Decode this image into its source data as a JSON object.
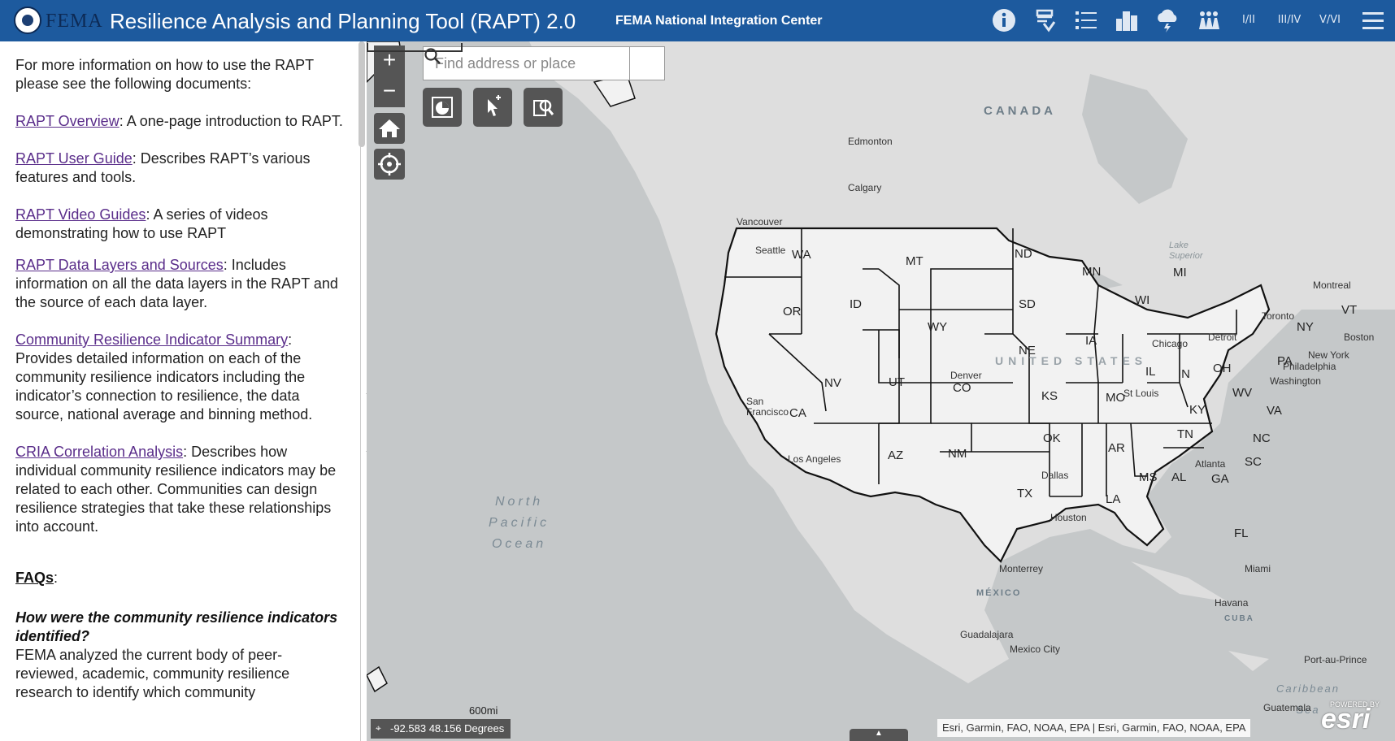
{
  "header": {
    "agency": "FEMA",
    "title": "Resilience Analysis and Planning Tool (RAPT) 2.0",
    "center": "FEMA National Integration Center",
    "icons": [
      "info-icon",
      "layer-list-icon",
      "legend-icon",
      "building-icon",
      "storm-icon",
      "population-icon",
      "region-i-ii-icon",
      "region-iii-iv-icon",
      "region-v-vi-icon",
      "menu-icon"
    ],
    "icon_labels": {
      "r12": "I/II",
      "r34": "III/IV",
      "r56": "V/VI"
    }
  },
  "panel": {
    "intro": "For more information on how to use the RAPT please see the following documents:",
    "docs": [
      {
        "link": "RAPT Overview",
        "text": ": A one-page introduction to RAPT."
      },
      {
        "link": "RAPT User Guide",
        "text": ": Describes RAPT’s various features and tools."
      },
      {
        "link": "RAPT Video Guides",
        "text": ": A series of videos demonstrating how to use RAPT"
      },
      {
        "link": "RAPT Data Layers and Sources",
        "text": ": Includes information on all the data layers in the RAPT and the source of each data layer."
      },
      {
        "link": "Community Resilience Indicator Summary",
        "text": ": Provides detailed information on each of the community resilience indicators including the indicator’s connection to resilience, the data source, national average and binning method."
      },
      {
        "link": "CRIA Correlation Analysis",
        "text": ": Describes how individual community resilience indicators may be related to each other. Communities can design resilience strategies that take these relationships into account."
      }
    ],
    "faq_heading": "FAQs",
    "faq_colon": ":",
    "faq_question": "How were the community resilience indicators identified?",
    "faq_answer": "FEMA analyzed the current body of peer-reviewed, academic, community resilience research to identify which community"
  },
  "map": {
    "search_placeholder": "Find address or place",
    "zoom_in": "+",
    "zoom_out": "−",
    "states": [
      {
        "abbr": "WA"
      },
      {
        "abbr": "OR"
      },
      {
        "abbr": "CA"
      },
      {
        "abbr": "ID"
      },
      {
        "abbr": "NV"
      },
      {
        "abbr": "MT"
      },
      {
        "abbr": "WY"
      },
      {
        "abbr": "UT"
      },
      {
        "abbr": "AZ"
      },
      {
        "abbr": "CO"
      },
      {
        "abbr": "NM"
      },
      {
        "abbr": "ND"
      },
      {
        "abbr": "SD"
      },
      {
        "abbr": "NE"
      },
      {
        "abbr": "KS"
      },
      {
        "abbr": "OK"
      },
      {
        "abbr": "TX"
      },
      {
        "abbr": "MN"
      },
      {
        "abbr": "IA"
      },
      {
        "abbr": "MO"
      },
      {
        "abbr": "AR"
      },
      {
        "abbr": "LA"
      },
      {
        "abbr": "WI"
      },
      {
        "abbr": "IL"
      },
      {
        "abbr": "MI"
      },
      {
        "abbr": "IN"
      },
      {
        "abbr": "OH"
      },
      {
        "abbr": "KY"
      },
      {
        "abbr": "TN"
      },
      {
        "abbr": "MS"
      },
      {
        "abbr": "AL"
      },
      {
        "abbr": "GA"
      },
      {
        "abbr": "FL"
      },
      {
        "abbr": "SC"
      },
      {
        "abbr": "NC"
      },
      {
        "abbr": "VA"
      },
      {
        "abbr": "WV"
      },
      {
        "abbr": "PA"
      },
      {
        "abbr": "NY"
      },
      {
        "abbr": "VT"
      }
    ],
    "cities": [
      "Edmonton",
      "Calgary",
      "Vancouver",
      "Seattle",
      "San Francisco",
      "Los Angeles",
      "Denver",
      "Dallas",
      "Houston",
      "St Louis",
      "Chicago",
      "Detroit",
      "Toronto",
      "Montreal",
      "Boston",
      "New York",
      "Philadelphia",
      "Washington",
      "Atlanta",
      "Miami",
      "Monterrey",
      "Havana",
      "Guadalajara",
      "Mexico City",
      "Guatemala",
      "Port-au-Prince"
    ],
    "lake_labels": [
      "Lake Superior"
    ],
    "countries": [
      "CANADA",
      "UNITED STATES",
      "MÉXICO",
      "CUBA"
    ],
    "ocean": [
      "North",
      "Pacific",
      "Ocean"
    ],
    "sea": "Caribbean Sea",
    "scale": "600mi",
    "coords": "-92.583 48.156 Degrees",
    "attribution": "Esri, Garmin, FAO, NOAA, EPA | Esri, Garmin, FAO, NOAA, EPA",
    "esri_powered": "POWERED BY",
    "esri": "esri"
  }
}
